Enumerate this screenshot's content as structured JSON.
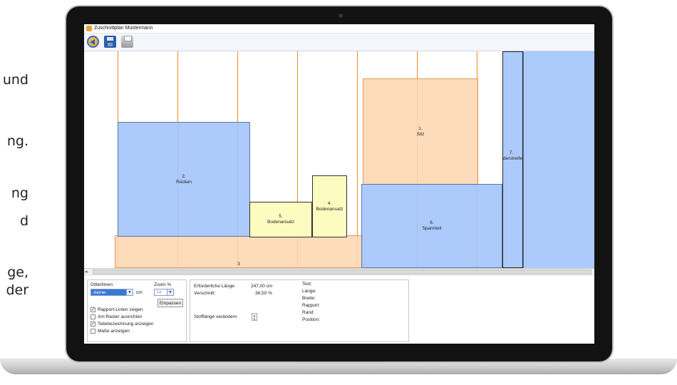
{
  "side_text": [
    "und",
    "ng.",
    "ng",
    "d",
    "ge,",
    "der"
  ],
  "window": {
    "title": "Zuschnittplan Mustermann"
  },
  "toolbar": {
    "icons": [
      "back-icon",
      "save-icon",
      "print-icon"
    ]
  },
  "pieces": [
    {
      "number": "1.",
      "name": "Sitz",
      "color": "orange"
    },
    {
      "number": "2.",
      "name": "Rücken",
      "color": "blue"
    },
    {
      "number": "3",
      "name": "",
      "color": "orange"
    },
    {
      "number": "4.",
      "name": "Bodenansatz",
      "color": "yellow"
    },
    {
      "number": "5.",
      "name": "Bodenansatz",
      "color": "yellow"
    },
    {
      "number": "6.",
      "name": "Spannteil",
      "color": "blue"
    },
    {
      "number": "7.",
      "name": "ederstreife",
      "color": "blue"
    }
  ],
  "colors": {
    "rapport_line": "#f08a1c",
    "orange_piece": "#fdd6af",
    "blue_piece": "#a4c4fc",
    "yellow_piece": "#fdfcc0"
  },
  "grid_panel": {
    "gitterlinien_label": "Gitterlinien",
    "gitterlinien_value": "-keine-",
    "unit": "cm",
    "zoom_label": "Zoom %",
    "zoom_value": "74",
    "fit_button": "Einpassen",
    "options": [
      {
        "label": "Rapport-Linien zeigen",
        "checked": true
      },
      {
        "label": "Am Raster ausrichten",
        "checked": false
      },
      {
        "label": "Teilebezeichnung anzeigen",
        "checked": true
      },
      {
        "label": "Maße anzeigen",
        "checked": false
      }
    ]
  },
  "info_panel": {
    "length_label": "Erforderliche Länge:",
    "length_value": "247,00 cm",
    "waste_label": "Verschnitt:",
    "waste_value": "36,50 %",
    "change_label": "Stofflänge verändern",
    "details": [
      "Text:",
      "Länge:",
      "Breite:",
      "Rapport:",
      "Rand:",
      "Position:"
    ]
  }
}
